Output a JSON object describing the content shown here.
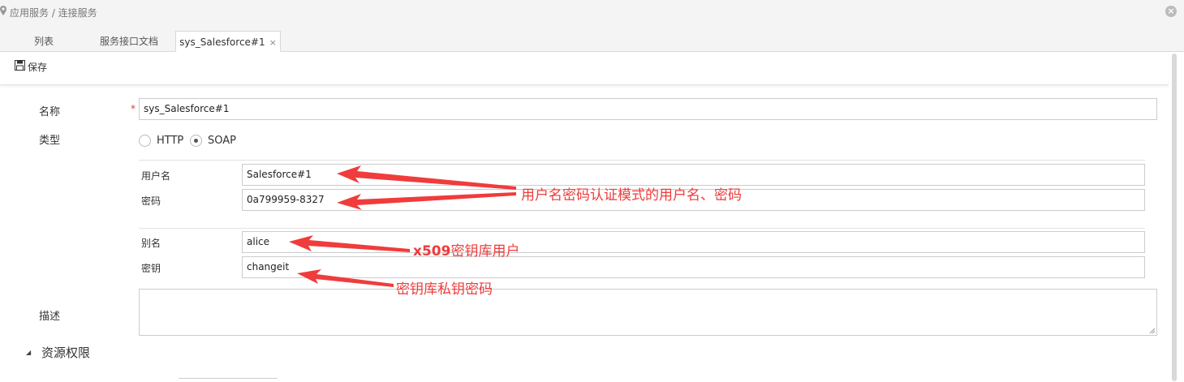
{
  "breadcrumb": "应用服务 / 连接服务",
  "tabs": [
    {
      "label": "列表"
    },
    {
      "label": "服务接口文档"
    },
    {
      "label": "sys_Salesforce#1",
      "close": "×"
    }
  ],
  "toolbar": {
    "save_label": "保存"
  },
  "form": {
    "name_label": "名称",
    "required_mark": "*",
    "name_value": "sys_Salesforce#1",
    "type_label": "类型",
    "type_options": [
      "HTTP",
      "SOAP"
    ],
    "type_selected": "SOAP",
    "username_label": "用户名",
    "username_value": "Salesforce#1",
    "password_label": "密码",
    "password_value": "0a799959-8327",
    "alias_label": "别名",
    "alias_value": "alice",
    "key_label": "密钥",
    "key_value": "changeit",
    "desc_label": "描述",
    "desc_value": ""
  },
  "section": {
    "label": "资源权限"
  },
  "annotations": {
    "cred_note": "用户名密码认证模式的用户名、密码",
    "x509_bold": "x509",
    "x509_rest": "密钥库用户",
    "key_note": "密钥库私钥密码"
  },
  "colors": {
    "annotation": "#ee3b3b",
    "required": "#e33333"
  }
}
